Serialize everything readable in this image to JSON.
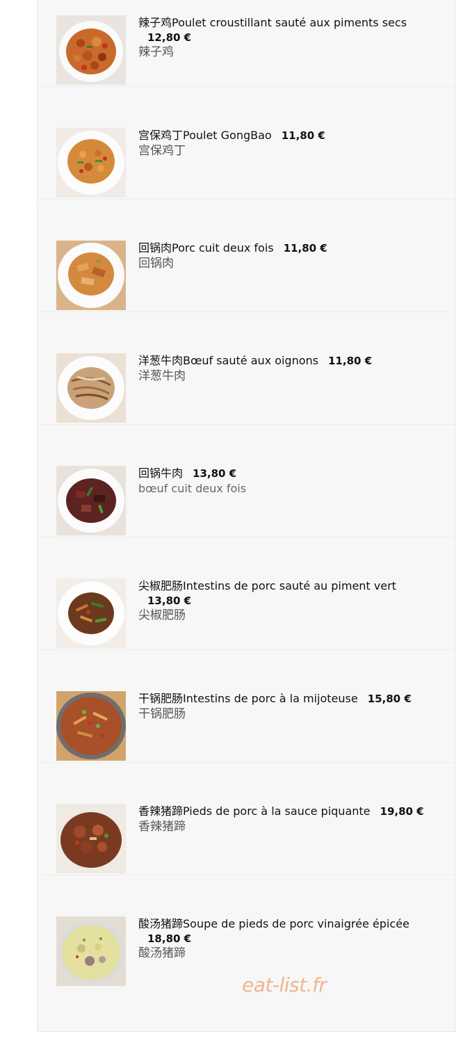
{
  "items": [
    {
      "title": "辣子鸡Poulet croustillant sauté aux piments secs",
      "price": "12,80 €",
      "subtitle": "辣子鸡",
      "image": "spicy-chicken-dish"
    },
    {
      "title": "宫保鸡丁Poulet GongBao",
      "price": "11,80 €",
      "subtitle": "宫保鸡丁",
      "image": "kung-pao-chicken-dish"
    },
    {
      "title": "回锅肉Porc cuit deux fois",
      "price": "11,80 €",
      "subtitle": "回锅肉",
      "image": "twice-cooked-pork-dish"
    },
    {
      "title": "洋葱牛肉Bœuf sauté aux oignons",
      "price": "11,80 €",
      "subtitle": "洋葱牛肉",
      "image": "beef-onion-dish"
    },
    {
      "title": "回锅牛肉",
      "price": "13,80 €",
      "subtitle": "bœuf cuit deux fois",
      "image": "twice-cooked-beef-dish"
    },
    {
      "title": "尖椒肥肠Intestins de porc sauté au piment vert",
      "price": "13,80 €",
      "subtitle": "尖椒肥肠",
      "image": "pork-intestine-pepper-dish"
    },
    {
      "title": "干锅肥肠Intestins de porc à la mijoteuse",
      "price": "15,80 €",
      "subtitle": "干锅肥肠",
      "image": "dry-pot-intestine-dish"
    },
    {
      "title": "香辣猪蹄Pieds de porc à la sauce piquante",
      "price": "19,80 €",
      "subtitle": "香辣猪蹄",
      "image": "spicy-pork-feet-dish"
    },
    {
      "title": "酸汤猪蹄Soupe de pieds de porc vinaigrée épicée",
      "price": "18,80 €",
      "subtitle": "酸汤猪蹄",
      "image": "sour-soup-pork-feet-dish"
    }
  ],
  "watermark": "eat-list.fr",
  "colors": {
    "panel_bg": "#f7f7f7",
    "watermark": "#f1b58f"
  }
}
